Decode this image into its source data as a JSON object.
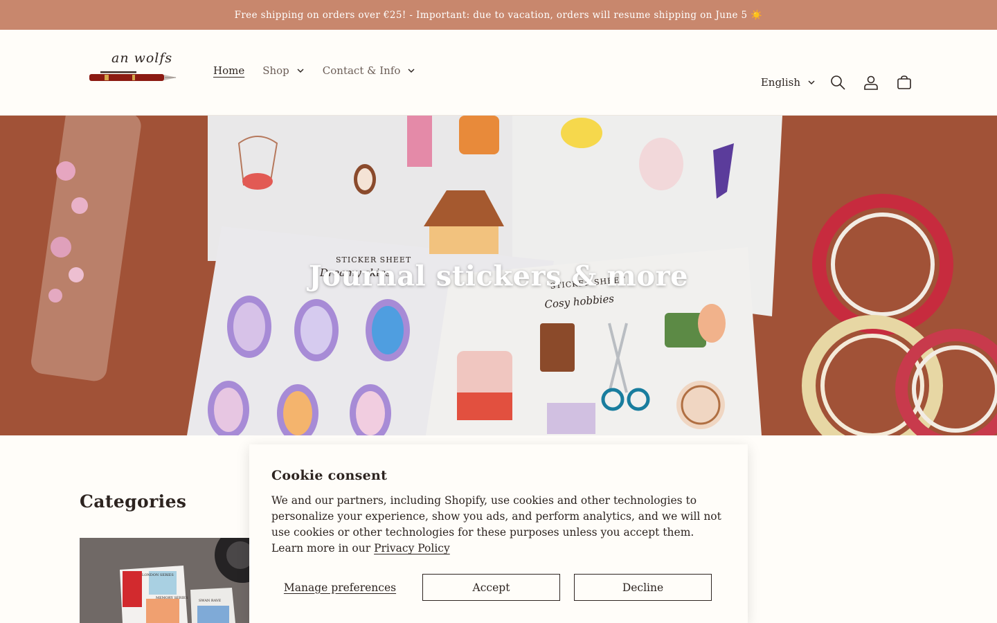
{
  "announcement": {
    "text": "Free shipping on orders over €25! - Important: due to vacation, orders will resume shipping on June 5 ☀️"
  },
  "header": {
    "logo_text": "an wolfs",
    "nav": [
      {
        "label": "Home",
        "active": true
      },
      {
        "label": "Shop",
        "has_dropdown": true
      },
      {
        "label": "Contact & Info",
        "has_dropdown": true
      }
    ],
    "language": "English",
    "icons": [
      "search-icon",
      "account-icon",
      "cart-icon"
    ]
  },
  "hero": {
    "title": "Journal stickers & more",
    "sticker_sheet_label_1": "STICKER SHEET",
    "sticker_sheet_title_1": "Dreamy skies",
    "sticker_sheet_label_2": "STICKER SHEET",
    "sticker_sheet_title_2": "Cosy hobbies"
  },
  "categories": {
    "title": "Categories",
    "card_labels": [
      "LONDON SERIES",
      "MEMORY SERIES",
      "SWAN RAVE"
    ]
  },
  "cookie": {
    "title": "Cookie consent",
    "body": "We and our partners, including Shopify, use cookies and other technologies to personalize your experience, show you ads, and perform analytics, and we will not use cookies or other technologies for these purposes unless you accept them. Learn more in our ",
    "policy_link": "Privacy Policy",
    "manage_label": "Manage preferences",
    "accept_label": "Accept",
    "decline_label": "Decline"
  },
  "colors": {
    "announcement_bg": "#c8876d",
    "page_bg": "#fffdf9",
    "text": "#2d2420",
    "hero_bg": "#a9593c"
  }
}
